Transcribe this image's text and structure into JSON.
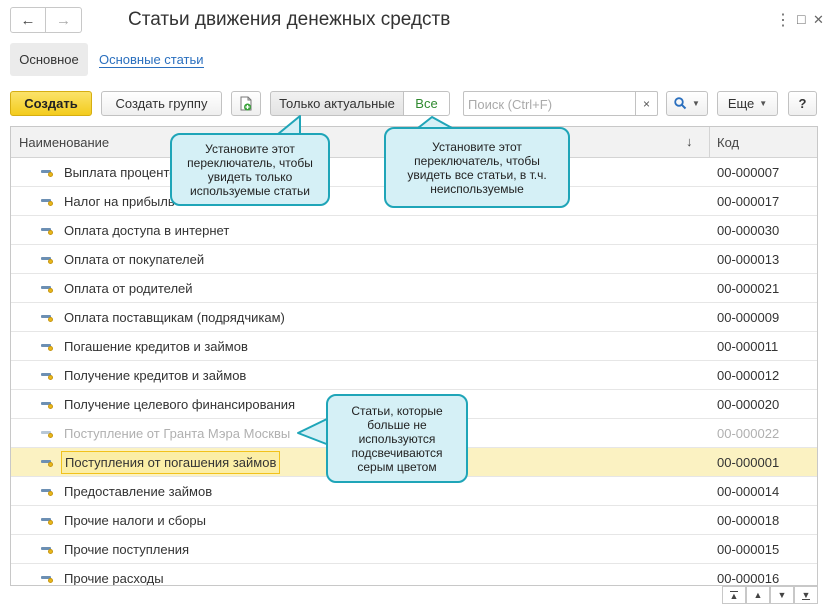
{
  "header": {
    "title": "Статьи движения денежных средств",
    "back_icon": "←",
    "forward_icon": "→",
    "menu_icon": "⋮",
    "maximize_icon": "□",
    "close_icon": "✕"
  },
  "tabs": {
    "main": "Основное",
    "link": "Основные статьи"
  },
  "toolbar": {
    "create": "Создать",
    "create_group": "Создать группу",
    "only_actual": "Только актуальные",
    "all": "Все",
    "search_placeholder": "Поиск (Ctrl+F)",
    "search_clear": "×",
    "more": "Еще",
    "help": "?"
  },
  "table": {
    "columns": {
      "name": "Наименование",
      "sort_icon": "↓",
      "code": "Код"
    },
    "rows": [
      {
        "name": "Выплата процентов",
        "code": "00-000007",
        "state": "normal"
      },
      {
        "name": "Налог на прибыль",
        "code": "00-000017",
        "state": "normal"
      },
      {
        "name": "Оплата доступа в интернет",
        "code": "00-000030",
        "state": "normal"
      },
      {
        "name": "Оплата от покупателей",
        "code": "00-000013",
        "state": "normal"
      },
      {
        "name": "Оплата от родителей",
        "code": "00-000021",
        "state": "normal"
      },
      {
        "name": "Оплата поставщикам (подрядчикам)",
        "code": "00-000009",
        "state": "normal"
      },
      {
        "name": "Погашение кредитов и займов",
        "code": "00-000011",
        "state": "normal"
      },
      {
        "name": "Получение кредитов и займов",
        "code": "00-000012",
        "state": "normal"
      },
      {
        "name": "Получение целевого финансирования",
        "code": "00-000020",
        "state": "normal"
      },
      {
        "name": "Поступление от Гранта Мэра Москвы",
        "code": "00-000022",
        "state": "grey"
      },
      {
        "name": "Поступления от погашения займов",
        "code": "00-000001",
        "state": "selected"
      },
      {
        "name": "Предоставление займов",
        "code": "00-000014",
        "state": "normal"
      },
      {
        "name": "Прочие налоги и сборы",
        "code": "00-000018",
        "state": "normal"
      },
      {
        "name": "Прочие поступления",
        "code": "00-000015",
        "state": "normal"
      },
      {
        "name": "Прочие расходы",
        "code": "00-000016",
        "state": "normal"
      }
    ]
  },
  "callouts": {
    "actual": "Установите этот переключатель, чтобы увидеть только используемые статьи",
    "all": "Установите этот переключатель, чтобы увидеть все статьи, в т.ч. неиспользуемые",
    "grey": "Статьи, которые больше не используются подсвечиваются серым цветом"
  },
  "bottom_nav": {
    "first": "▲",
    "up": "▲",
    "down": "▼",
    "last": "▼"
  },
  "colors": {
    "accent_create": "#f3cc1d",
    "all_toggle_text": "#2f8a2f",
    "callout_border": "#1fa5b8",
    "callout_fill": "#d5f0f6",
    "selected_row": "#fbf2c2",
    "link": "#2a6fbe"
  }
}
